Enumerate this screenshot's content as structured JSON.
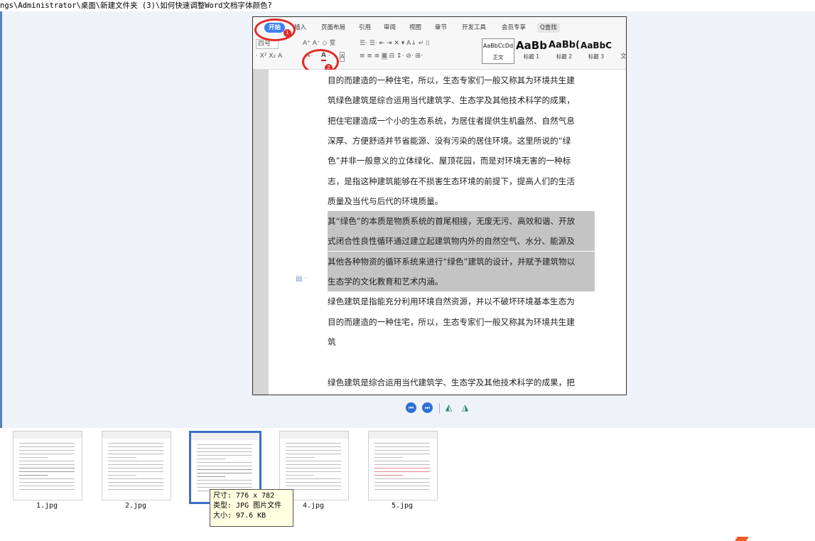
{
  "path_text": "ngs\\Administrator\\桌面\\新建文件夹 (3)\\如何快速调整Word文档字体颜色?",
  "ribbon": {
    "tabs": [
      "开始",
      "插入",
      "页面布局",
      "引用",
      "审阅",
      "视图",
      "章节",
      "开发工具",
      "会员专享"
    ],
    "search": "Q查找",
    "font_size": "四号",
    "styles": [
      {
        "sample": "AaBbCcDd",
        "name": "正文"
      },
      {
        "sample": "AaBb",
        "name": "标题 1"
      },
      {
        "sample": "AaBb(",
        "name": "标题 2"
      },
      {
        "sample": "AaBbC",
        "name": "标题 3"
      }
    ],
    "more_style": "文",
    "badge_1": "1",
    "badge_2": "2"
  },
  "document": {
    "lines": [
      "目的而建造的一种住宅，所以，生态专家们一般又称其为环境共生建",
      "筑绿色建筑是综合运用当代建筑学、生态学及其他技术科学的成果，",
      "把住宅建造成一个小的生态系统，为居住者提供生机盎然、自然气息",
      "深厚、方便舒适并节省能源、没有污染的居住环境。这里所说的“绿",
      "色”并非一般意义的立体绿化、屋顶花园，而是对环境无害的一种标",
      "志，是指这种建筑能够在不损害生态环境的前提下，提高人们的生活",
      "质量及当代与后代的环境质量。",
      "其“绿色”的本质是物质系统的首尾相接，无废无污、高效和谐、开放",
      "式闭合性良性循环通过建立起建筑物内外的自然空气、水分、能源及",
      "其他各种物资的循环系统来进行“绿色”建筑的设计，并赋予建筑物以",
      "生态学的文化教育和艺术内涵。",
      "绿色建筑是指能充分利用环境自然资源，并以不破坏环境基本生态为",
      "目的而建造的一种住宅，所以，生态专家们一般又称其为环境共生建",
      "筑",
      "",
      "绿色建筑是综合运用当代建筑学、生态学及其他技术科学的成果，把"
    ],
    "highlighted_lines": [
      7,
      8,
      9,
      10
    ]
  },
  "thumbnails": [
    {
      "label": "1.jpg"
    },
    {
      "label": "2.jpg"
    },
    {
      "label": "3.jpg"
    },
    {
      "label": "4.jpg"
    },
    {
      "label": "5.jpg"
    }
  ],
  "tooltip": {
    "size": "尺寸: 776 x 782",
    "type": "类型: JPG 图片文件",
    "filesize": "大小: 97.6 KB"
  },
  "colors": {
    "accent": "#3b7ff2",
    "annotation_red": "#e12b2b",
    "viewer_bg": "#eef2f9",
    "highlight": "#c4c4c4"
  }
}
